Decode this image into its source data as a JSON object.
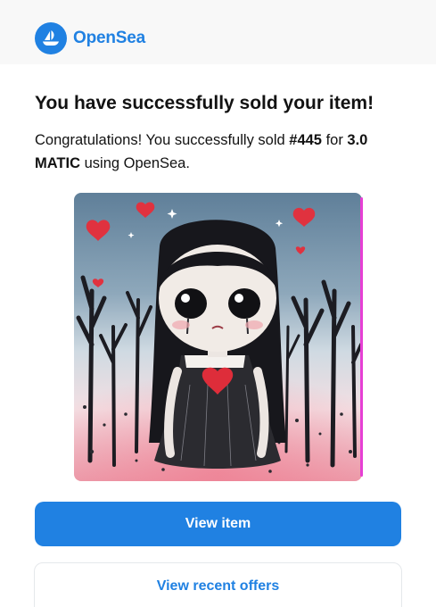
{
  "header": {
    "brand": "OpenSea",
    "logo_icon": "opensea-boat-icon",
    "brand_color": "#2081e2"
  },
  "email": {
    "title": "You have successfully sold your item!",
    "message_prefix": "Congratulations! You successfully sold ",
    "item_id": "#445",
    "message_for": " for ",
    "price": "3.0 MATIC",
    "message_suffix": " using OpenSea."
  },
  "nft_image": {
    "description_icon": "gothic-girl-artwork"
  },
  "actions": {
    "view_item": "View item",
    "view_recent_offers": "View recent offers",
    "primary_color": "#2081e2"
  }
}
